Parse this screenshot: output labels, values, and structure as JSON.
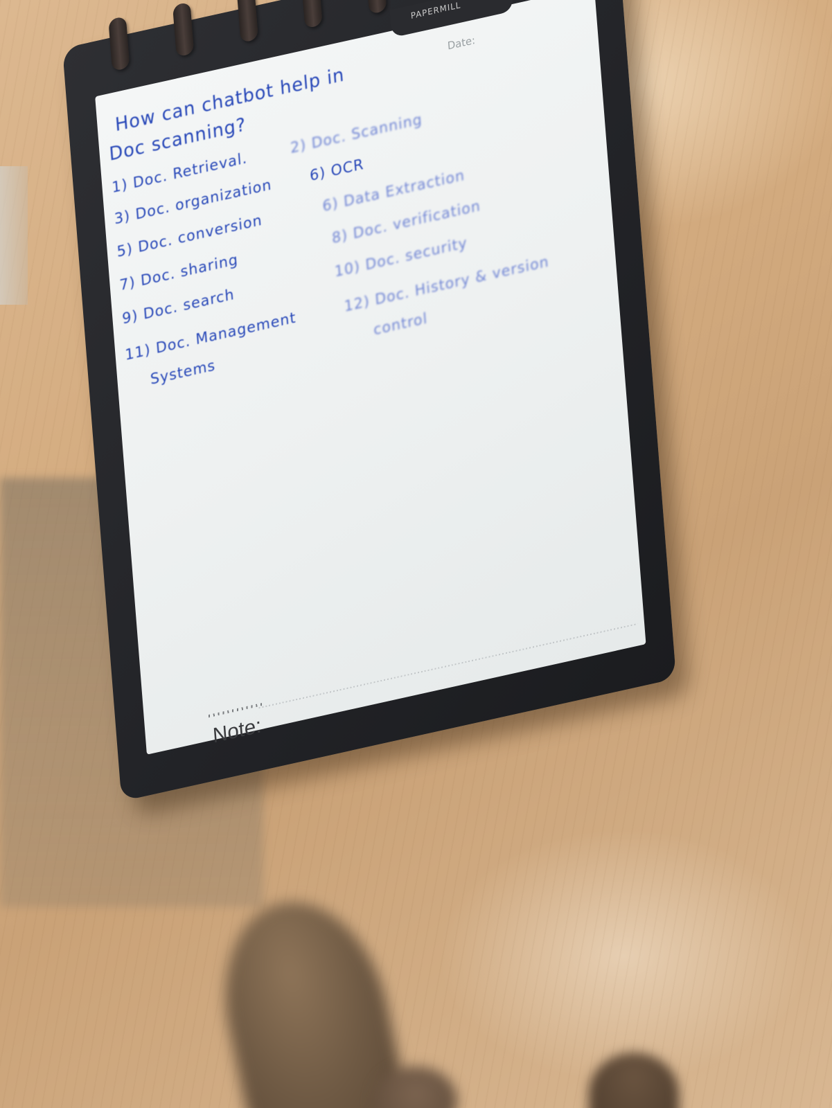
{
  "notebook": {
    "brand": "PAPERMILL",
    "date_label": "Date:",
    "note_label": "Note:"
  },
  "handwriting": {
    "title_line_1": "How can chatbot help in",
    "title_line_2": "Doc scanning?",
    "items": [
      {
        "left": "1) Doc. Retrieval.",
        "right": "2) Doc. Scanning"
      },
      {
        "left": "3) Doc. organization",
        "right": "6) OCR"
      },
      {
        "left": "5) Doc. conversion",
        "right": "6) Data Extraction"
      },
      {
        "left": "7) Doc. sharing",
        "right": "8) Doc. verification"
      },
      {
        "left": "9) Doc. search",
        "right": "10) Doc. security"
      },
      {
        "left": "11) Doc. Management",
        "right": "12) Doc. History & version"
      },
      {
        "left": "Systems",
        "right": "control"
      }
    ]
  }
}
